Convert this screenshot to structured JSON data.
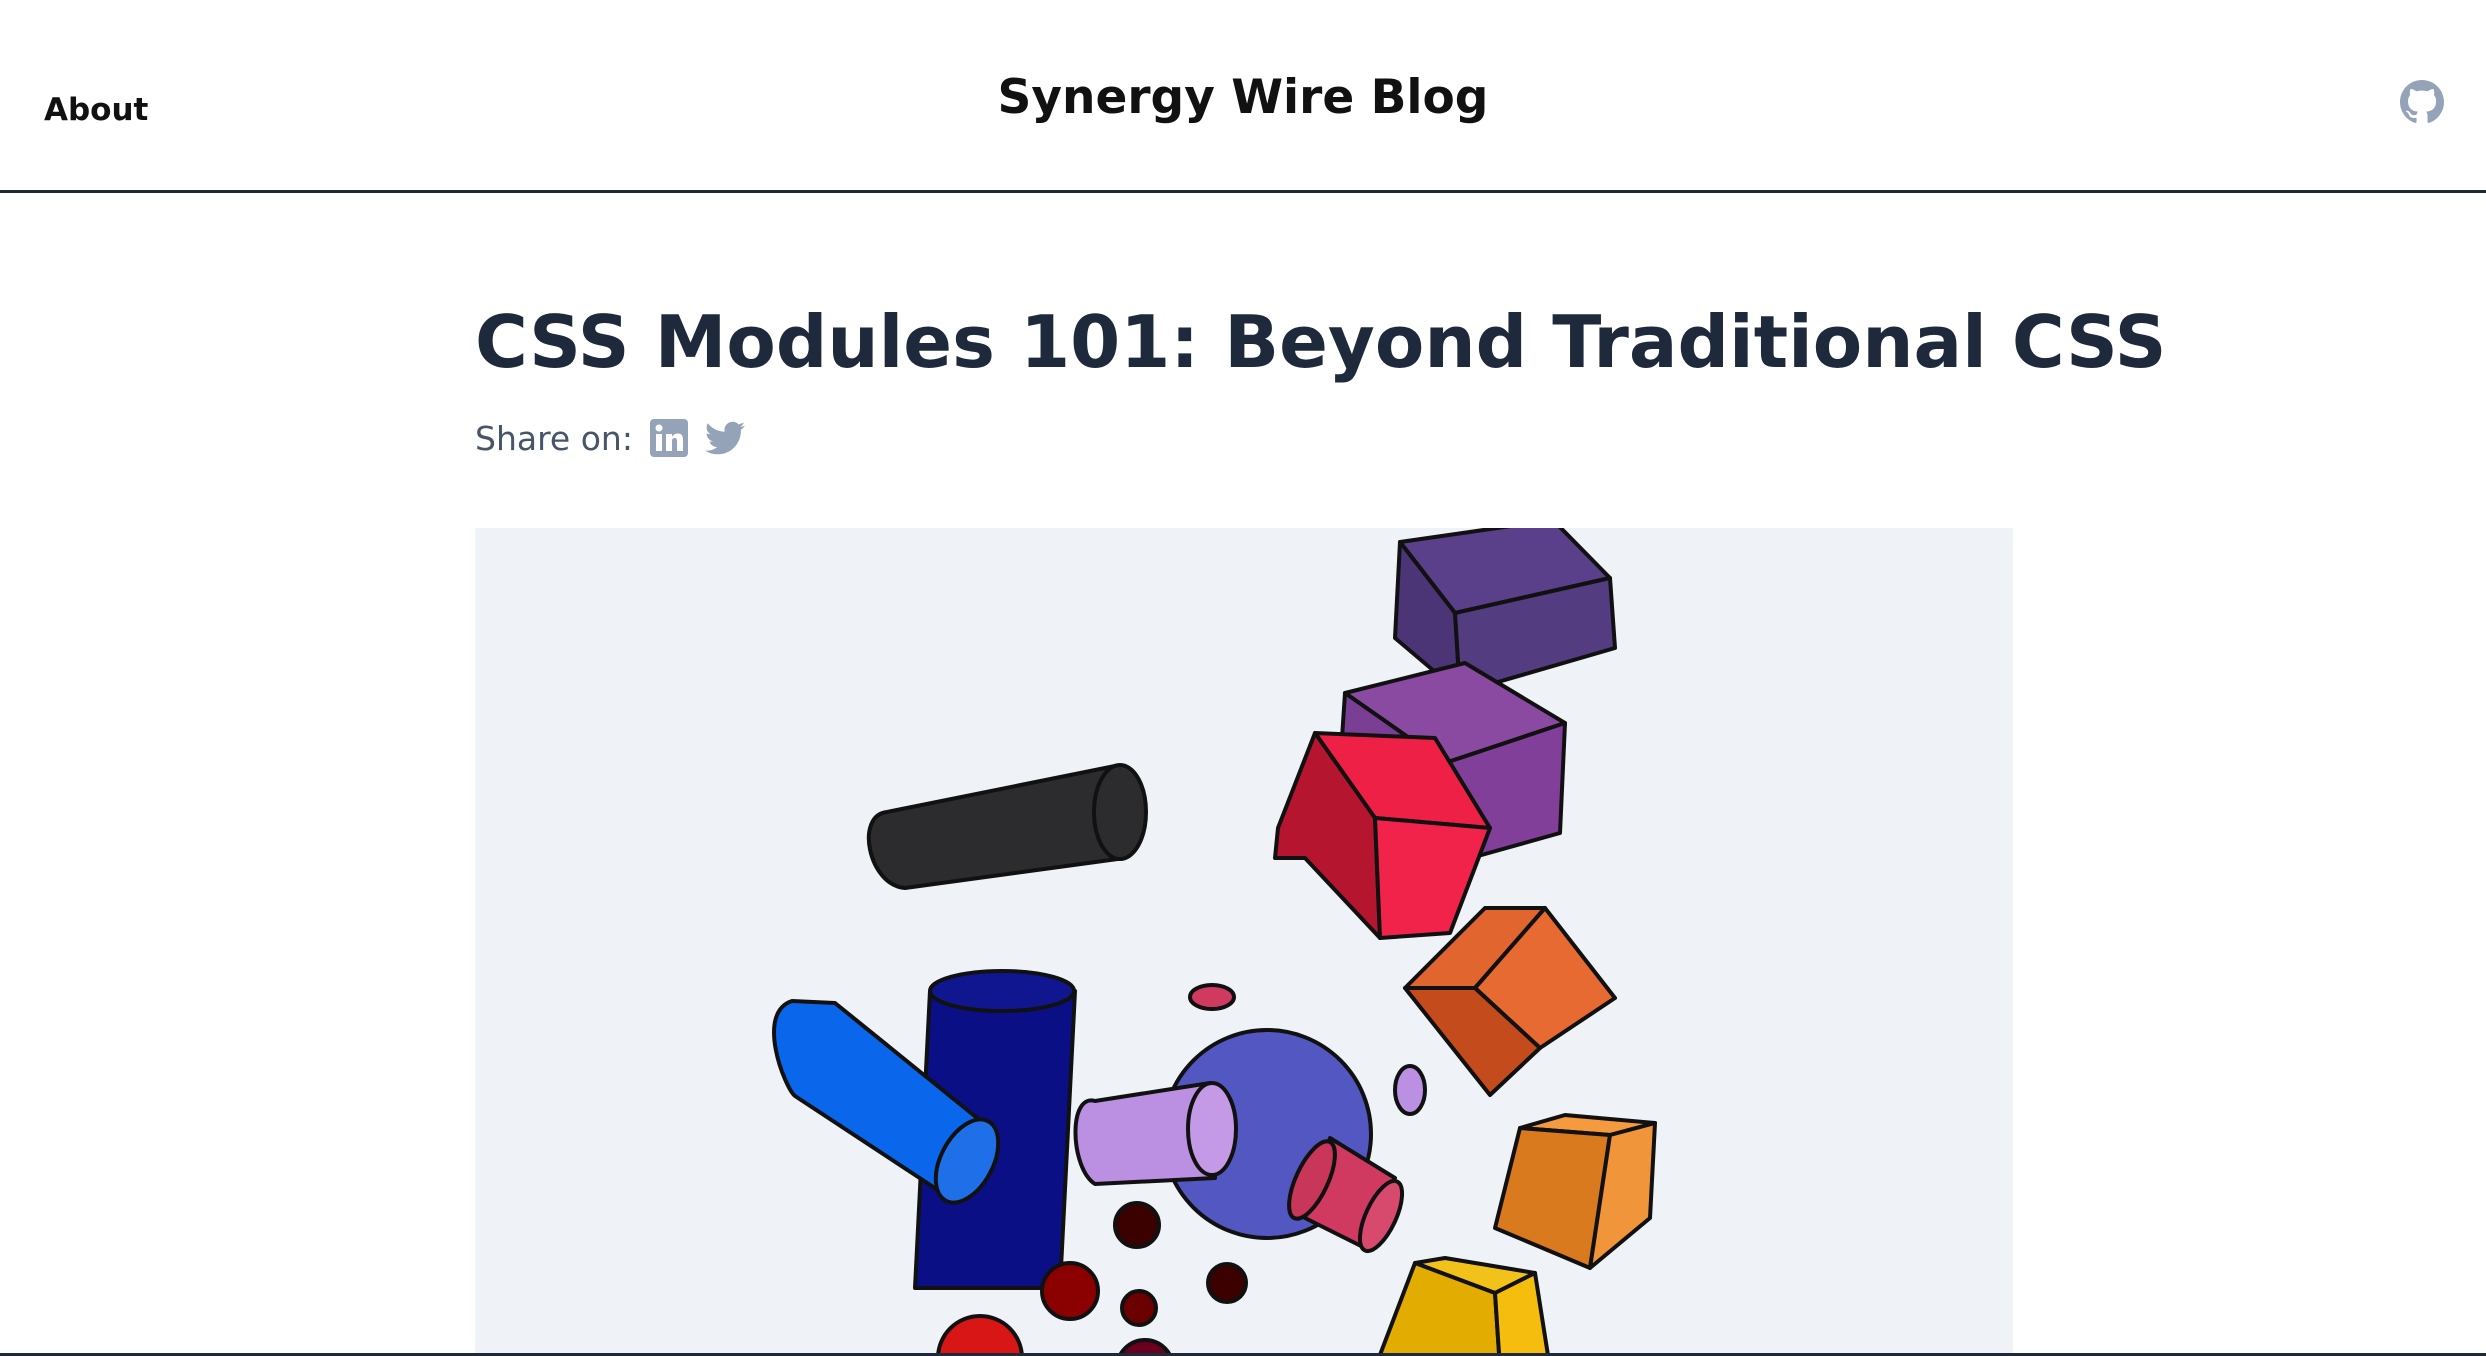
{
  "header": {
    "nav_about": "About",
    "site_title": "Synergy Wire Blog",
    "github_icon": "github-icon"
  },
  "article": {
    "title": "CSS Modules 101: Beyond Traditional CSS",
    "share_label": "Share on:",
    "share_icons": [
      "linkedin-icon",
      "twitter-icon"
    ],
    "hero_image": "colorful-3d-shapes-illustration"
  },
  "colors": {
    "title_text": "#1e293b",
    "muted_text": "#475569",
    "icon_gray": "#94a3b8",
    "hero_background": "#eff3f7",
    "header_border": "#1f2937"
  }
}
